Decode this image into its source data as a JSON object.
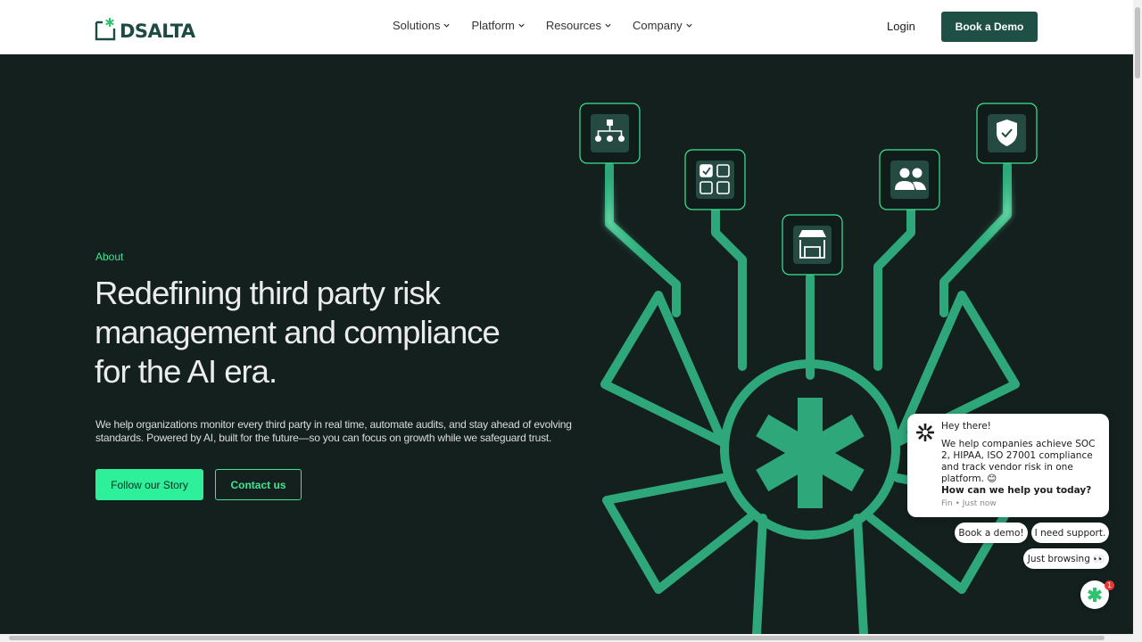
{
  "brand": {
    "name": "DSALTA"
  },
  "nav": {
    "items": [
      {
        "label": "Solutions"
      },
      {
        "label": "Platform"
      },
      {
        "label": "Resources"
      },
      {
        "label": "Company"
      }
    ],
    "login_label": "Login",
    "cta_label": "Book a Demo"
  },
  "hero": {
    "eyebrow": "About",
    "headline_lines": [
      "Redefining third party risk",
      "management and compliance",
      "for the AI era."
    ],
    "subtext": "We help organizations monitor every third party in real time, automate audits, and stay ahead of evolving standards. Powered by AI, built for the future—so you can focus on growth while we safeguard trust.",
    "primary_button": "Follow our Story",
    "secondary_button": "Contact us"
  },
  "art": {
    "icons": [
      "org-chart-icon",
      "checklist-grid-icon",
      "storefront-icon",
      "users-icon",
      "shield-check-icon"
    ],
    "accent": "#3ee595",
    "brand_dark": "#1e5045",
    "background": "#13201e"
  },
  "chat": {
    "greeting": "Hey there!",
    "message": "We help companies achieve SOC 2, HIPAA, ISO 27001 compliance and track vendor risk in one platform. 😊",
    "question": "How can we help you today?",
    "meta": "Fin • Just now",
    "quick_replies": [
      "Book a demo!",
      "I need support.",
      "Just browsing 👀"
    ],
    "badge_count": "1"
  }
}
